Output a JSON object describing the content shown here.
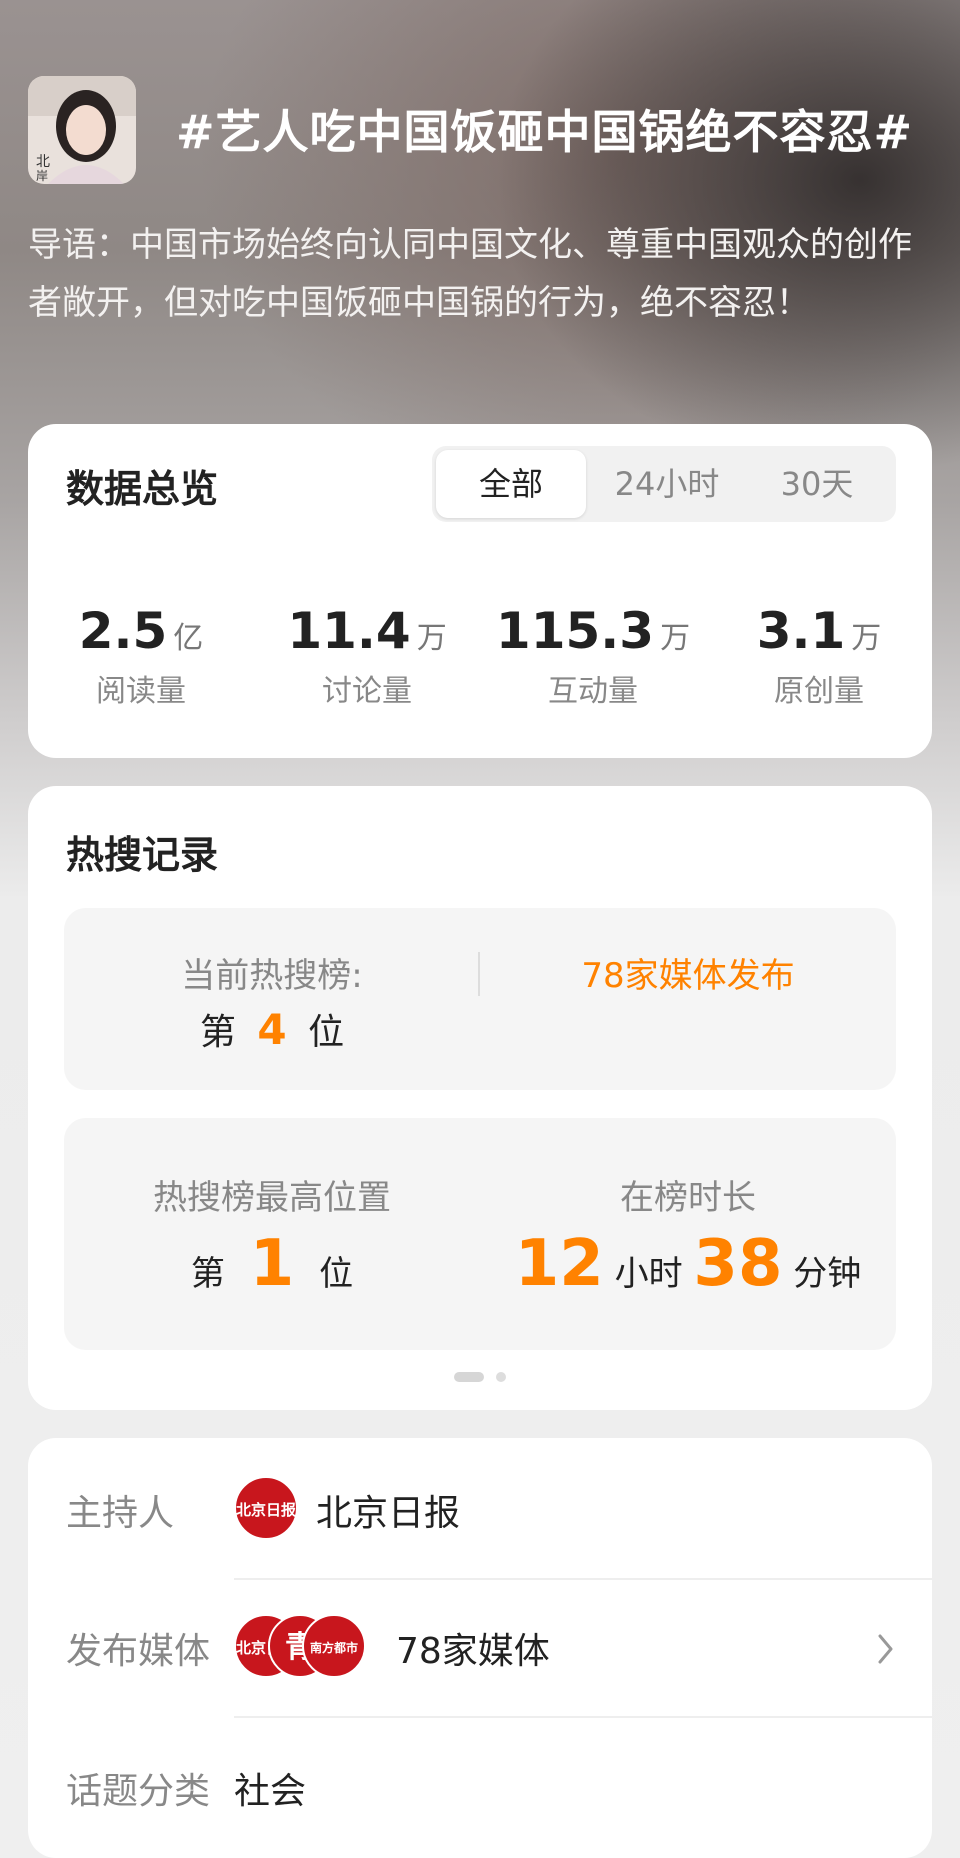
{
  "topic": {
    "title": "#艺人吃中国饭砸中国锅绝不容忍#",
    "intro": "导语：中国市场始终向认同中国文化、尊重中国观众的创作者敞开，但对吃中国饭砸中国锅的行为，绝不容忍！"
  },
  "overview": {
    "title": "数据总览",
    "tabs": [
      "全部",
      "24小时",
      "30天"
    ],
    "active_tab": "全部",
    "stats": [
      {
        "value": "2.5",
        "unit": "亿",
        "label": "阅读量"
      },
      {
        "value": "11.4",
        "unit": "万",
        "label": "讨论量"
      },
      {
        "value": "115.3",
        "unit": "万",
        "label": "互动量"
      },
      {
        "value": "3.1",
        "unit": "万",
        "label": "原创量"
      }
    ]
  },
  "hot": {
    "title": "热搜记录",
    "current_label": "当前热搜榜:",
    "current_prefix": "第",
    "current_rank": "4",
    "current_suffix": "位",
    "media_text": "78家媒体发布",
    "highest_label": "热搜榜最高位置",
    "highest_prefix": "第",
    "highest_rank": "1",
    "highest_suffix": "位",
    "duration_label": "在榜时长",
    "hours": "12",
    "hours_unit": "小时",
    "minutes": "38",
    "minutes_unit": "分钟"
  },
  "info": {
    "host_label": "主持人",
    "host_name": "北京日报",
    "host_logo_text": "北京日报",
    "media_label": "发布媒体",
    "media_text": "78家媒体",
    "media_logos": [
      "北京日报",
      "青",
      "南方都市"
    ],
    "category_label": "话题分类",
    "category_value": "社会"
  },
  "colors": {
    "accent": "#ff8200",
    "logo_red": "#c8161d"
  },
  "icons": {
    "chevron": "chevron-right-icon"
  }
}
